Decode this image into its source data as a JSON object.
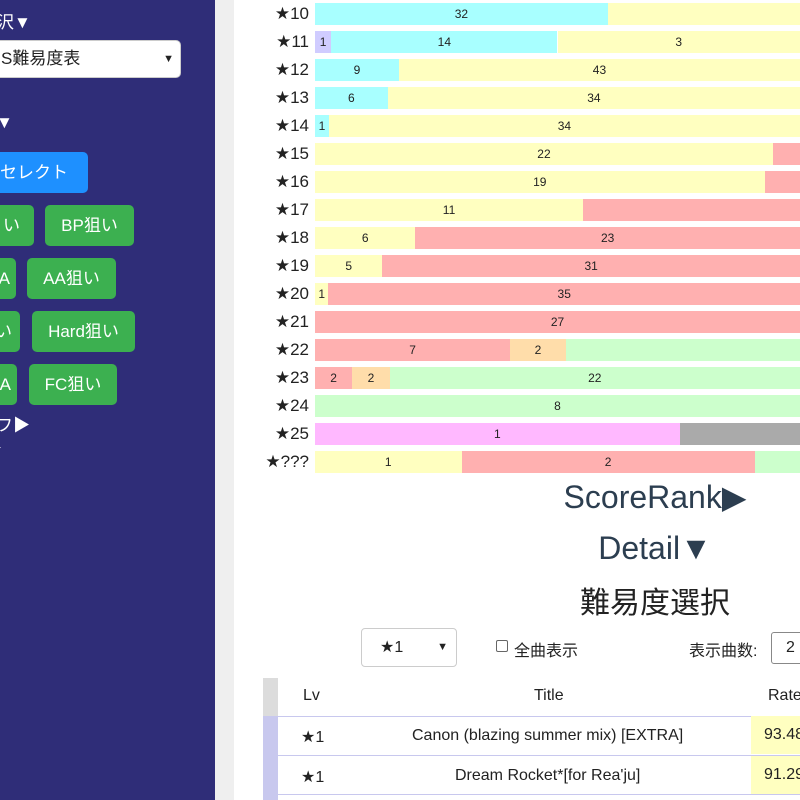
{
  "sidebar": {
    "header_fragment": "沢▼",
    "table_select_value": "S難易度表",
    "section_fragment": "▼",
    "select_button": "セレクト",
    "buttons": [
      {
        "label": "い"
      },
      {
        "label": "BP狙い"
      },
      {
        "label": "A"
      },
      {
        "label": "AA狙い"
      },
      {
        "label": "い"
      },
      {
        "label": "Hard狙い"
      },
      {
        "label": "A"
      },
      {
        "label": "FC狙い"
      }
    ],
    "collapsed_fragment": "フ▶",
    "bottom_fragment": "▶"
  },
  "colors": {
    "sidebar_bg": "#2f2d78",
    "primary_button": "#1e90ff",
    "success_button": "#3cb050",
    "lamp_noplay": "#ffffc0",
    "lamp_failed": "#ffb0b0",
    "lamp_easy": "#a8ffff",
    "lamp_assist": "#d0ccff",
    "lamp_normal": "#ffddaa",
    "lamp_hard": "#ccffcc",
    "lamp_exhard": "#ffb8ff",
    "lamp_gray": "#aaaaaa"
  },
  "lamp_rows": [
    {
      "level": "★10",
      "segments": [
        {
          "value": 32,
          "label": "32",
          "color": "#a8ffff"
        },
        {
          "value": 21,
          "label": "",
          "color": "#ffffc0"
        }
      ]
    },
    {
      "level": "★11",
      "segments": [
        {
          "value": 1,
          "label": "1",
          "color": "#d0ccff"
        },
        {
          "value": 14,
          "label": "14",
          "color": "#a8ffff"
        },
        {
          "value": 15,
          "label": "3",
          "color": "#ffffc0"
        }
      ]
    },
    {
      "level": "★12",
      "segments": [
        {
          "value": 9,
          "label": "9",
          "color": "#a8ffff"
        },
        {
          "value": 43,
          "label": "43",
          "color": "#ffffc0"
        }
      ]
    },
    {
      "level": "★13",
      "segments": [
        {
          "value": 6,
          "label": "6",
          "color": "#a8ffff"
        },
        {
          "value": 34,
          "label": "34",
          "color": "#ffffc0"
        }
      ]
    },
    {
      "level": "★14",
      "segments": [
        {
          "value": 1,
          "label": "1",
          "color": "#a8ffff"
        },
        {
          "value": 34,
          "label": "34",
          "color": "#ffffc0"
        }
      ]
    },
    {
      "level": "★15",
      "segments": [
        {
          "value": 22,
          "label": "22",
          "color": "#ffffc0"
        },
        {
          "value": 1.3,
          "label": "",
          "color": "#ffb0b0"
        }
      ]
    },
    {
      "level": "★16",
      "segments": [
        {
          "value": 19,
          "label": "19",
          "color": "#ffffc0"
        },
        {
          "value": 1.5,
          "label": "",
          "color": "#ffb0b0"
        }
      ]
    },
    {
      "level": "★17",
      "segments": [
        {
          "value": 11,
          "label": "11",
          "color": "#ffffc0"
        },
        {
          "value": 8.9,
          "label": "",
          "color": "#ffb0b0"
        }
      ]
    },
    {
      "level": "★18",
      "segments": [
        {
          "value": 6,
          "label": "6",
          "color": "#ffffc0"
        },
        {
          "value": 23,
          "label": "23",
          "color": "#ffb0b0"
        }
      ]
    },
    {
      "level": "★19",
      "segments": [
        {
          "value": 5,
          "label": "5",
          "color": "#ffffc0"
        },
        {
          "value": 31,
          "label": "31",
          "color": "#ffb0b0"
        }
      ]
    },
    {
      "level": "★20",
      "segments": [
        {
          "value": 1,
          "label": "1",
          "color": "#ffffc0"
        },
        {
          "value": 35,
          "label": "35",
          "color": "#ffb0b0"
        }
      ]
    },
    {
      "level": "★21",
      "segments": [
        {
          "value": 27,
          "label": "27",
          "color": "#ffb0b0"
        }
      ]
    },
    {
      "level": "★22",
      "segments": [
        {
          "value": 7,
          "label": "7",
          "color": "#ffb0b0"
        },
        {
          "value": 2,
          "label": "2",
          "color": "#ffddaa"
        },
        {
          "value": 8.4,
          "label": "",
          "color": "#ccffcc"
        }
      ]
    },
    {
      "level": "★23",
      "segments": [
        {
          "value": 2,
          "label": "2",
          "color": "#ffb0b0"
        },
        {
          "value": 2,
          "label": "2",
          "color": "#ffddaa"
        },
        {
          "value": 22,
          "label": "22",
          "color": "#ccffcc"
        }
      ]
    },
    {
      "level": "★24",
      "segments": [
        {
          "value": 8,
          "label": "8",
          "color": "#ccffcc"
        }
      ]
    },
    {
      "level": "★25",
      "segments": [
        {
          "value": 1,
          "label": "1",
          "color": "#ffb8ff"
        },
        {
          "value": 0.33,
          "label": "",
          "color": "#aaaaaa"
        }
      ]
    },
    {
      "level": "★???",
      "segments": [
        {
          "value": 1,
          "label": "1",
          "color": "#ffffc0"
        },
        {
          "value": 2,
          "label": "2",
          "color": "#ffb0b0"
        },
        {
          "value": 0.31,
          "label": "",
          "color": "#ccffcc"
        }
      ]
    }
  ],
  "headings": {
    "score_rank": "ScoreRank▶",
    "detail": "Detail▼",
    "difficulty_select": "難易度選択"
  },
  "filters": {
    "level_value": "★1",
    "show_all_label": "全曲表示",
    "show_all_checked": false,
    "count_label": "表示曲数:",
    "count_value": "2"
  },
  "table": {
    "headers": {
      "lv": "Lv",
      "title": "Title",
      "rate": "Rate"
    },
    "rows": [
      {
        "lv": "★1",
        "title": "Canon (blazing summer mix) [EXTRA]",
        "rate": "93.48"
      },
      {
        "lv": "★1",
        "title": "Dream Rocket*[for Rea'ju]",
        "rate": "91.29"
      }
    ]
  }
}
